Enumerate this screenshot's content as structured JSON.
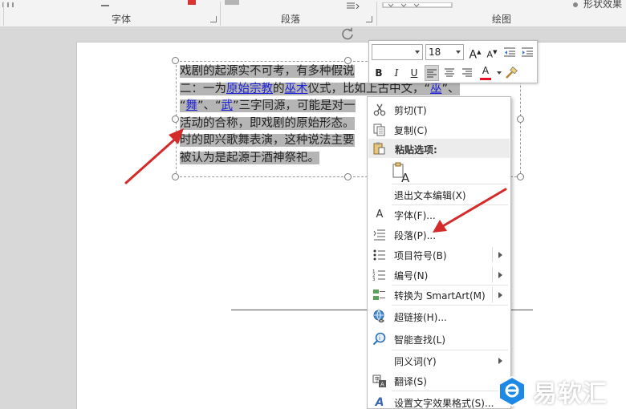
{
  "ribbon": {
    "group_font": "字体",
    "group_paragraph": "段落",
    "group_drawing": "绘图",
    "shape_effects": "形状效果"
  },
  "textbox": {
    "lines": [
      [
        {
          "t": "戏剧的起源实不可考，有多种假说",
          "c": "n"
        }
      ],
      [
        {
          "t": "二：一为",
          "c": "n"
        },
        {
          "t": "原始宗教",
          "c": "l"
        },
        {
          "t": "的",
          "c": "n"
        },
        {
          "t": "巫术",
          "c": "l"
        },
        {
          "t": "仪式，比如上古中文，“",
          "c": "n"
        },
        {
          "t": "巫",
          "c": "l"
        },
        {
          "t": "”、",
          "c": "n"
        }
      ],
      [
        {
          "t": "“",
          "c": "n"
        },
        {
          "t": "舞",
          "c": "l"
        },
        {
          "t": "”、“",
          "c": "n"
        },
        {
          "t": "武",
          "c": "l"
        },
        {
          "t": "”三字同源，可能是对一",
          "c": "n"
        }
      ],
      [
        {
          "t": "活动的合称，即戏剧的原始形态。",
          "c": "n"
        }
      ],
      [
        {
          "t": "时的即兴歌舞表演，这种说法主要",
          "c": "n"
        }
      ],
      [
        {
          "t": "被认为是起源于酒神祭祀。",
          "c": "n"
        }
      ]
    ]
  },
  "minitoolbar": {
    "font_name": "",
    "font_size": "18",
    "grow_font": "A",
    "shrink_font": "A",
    "bold": "B",
    "italic": "I",
    "underline": "U",
    "font_color": "A",
    "font_color_hex": "#e81123"
  },
  "context_menu": {
    "cut": "剪切(T)",
    "copy": "复制(C)",
    "paste_options": "粘贴选项:",
    "exit_edit": "退出文本编辑(X)",
    "font": "字体(F)...",
    "paragraph": "段落(P)...",
    "bullets": "项目符号(B)",
    "numbering": "编号(N)",
    "smartart": "转换为 SmartArt(M)",
    "hyperlink": "超链接(H)...",
    "smart_lookup": "智能查找(L)",
    "synonyms": "同义词(Y)",
    "translate": "翻译(S)",
    "text_effects": "设置文字效果格式(S)..."
  },
  "annotation": {
    "arrow_color": "#d42a2a"
  },
  "watermark": {
    "text": "易软汇"
  }
}
